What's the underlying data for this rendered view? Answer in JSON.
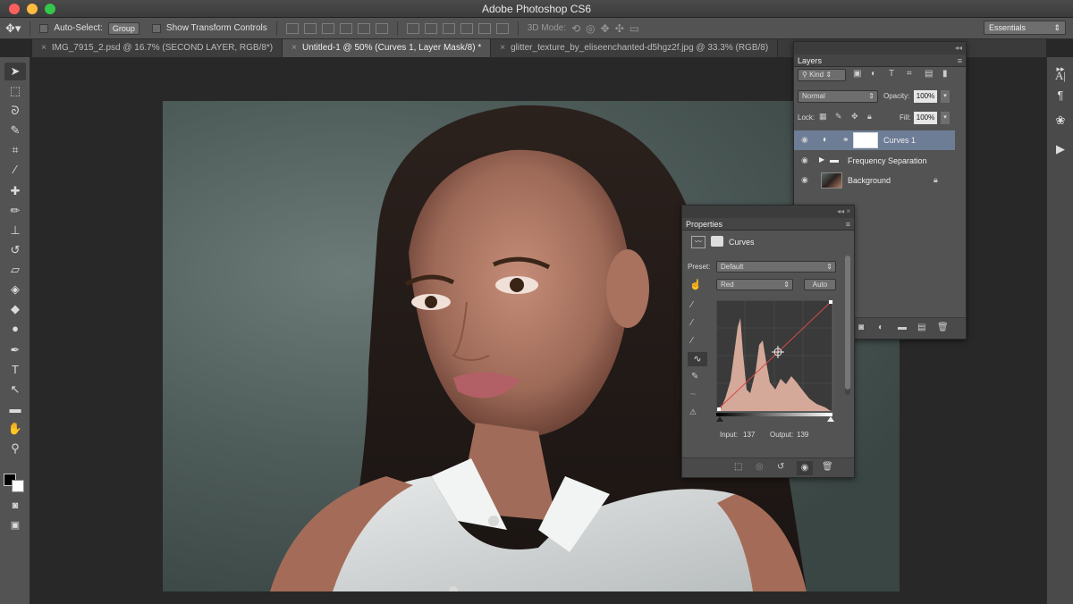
{
  "app": {
    "title": "Adobe Photoshop CS6"
  },
  "colors": {
    "chrome": "#535353",
    "canvas_bg": "#282828",
    "accent_layer": "#6d7d96"
  },
  "options_bar": {
    "auto_select_label": "Auto-Select:",
    "auto_select_value": "Group",
    "transform_label": "Show Transform Controls",
    "mode_3d_label": "3D Mode:",
    "workspace": "Essentials"
  },
  "tabs": [
    {
      "label": "IMG_7915_2.psd @ 16.7% (SECOND LAYER, RGB/8*)",
      "active": false
    },
    {
      "label": "Untitled-1 @ 50% (Curves 1, Layer Mask/8) *",
      "active": true
    },
    {
      "label": "glitter_texture_by_eliseenchanted-d5hgz2f.jpg @ 33.3% (RGB/8)",
      "active": false
    }
  ],
  "layers_panel": {
    "title": "Layers",
    "filter": "Kind",
    "blend_mode": "Normal",
    "opacity_label": "Opacity:",
    "opacity": "100%",
    "lock_label": "Lock:",
    "fill_label": "Fill:",
    "fill": "100%",
    "layers": [
      {
        "name": "Curves 1",
        "selected": true
      },
      {
        "name": "Frequency Separation",
        "selected": false
      },
      {
        "name": "Background",
        "selected": false
      }
    ]
  },
  "properties_panel": {
    "title": "Properties",
    "adjustment": "Curves",
    "preset_label": "Preset:",
    "preset": "Default",
    "channel": "Red",
    "auto_label": "Auto",
    "input_label": "Input:",
    "input_value": "137",
    "output_label": "Output:",
    "output_value": "139"
  }
}
